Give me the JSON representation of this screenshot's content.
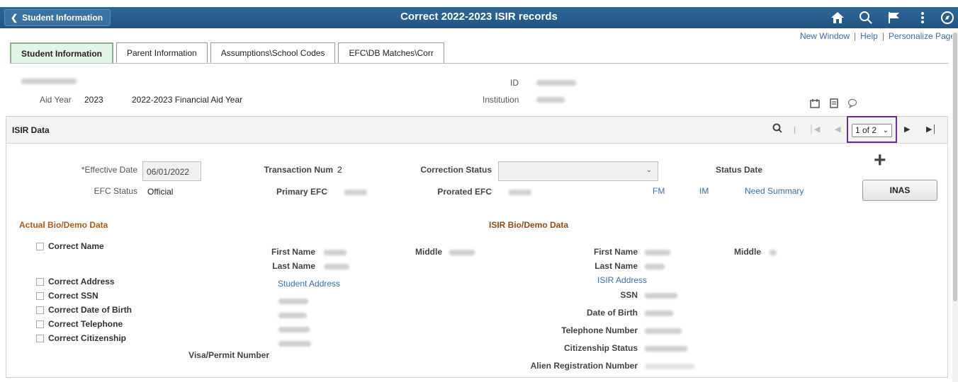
{
  "header": {
    "back_label": "Student Information",
    "title": "Correct 2022-2023 ISIR records",
    "icons": [
      "home-icon",
      "search-icon",
      "flag-icon",
      "more-icon",
      "navigator-icon"
    ]
  },
  "toplinks": {
    "new_window": "New Window",
    "help": "Help",
    "personalize": "Personalize Page"
  },
  "tabs": [
    {
      "label": "Student Information",
      "active": true
    },
    {
      "label": "Parent Information",
      "active": false
    },
    {
      "label": "Assumptions\\School Codes",
      "active": false
    },
    {
      "label": "EFC\\DB Matches\\Corr",
      "active": false
    }
  ],
  "info": {
    "aid_year_label": "Aid Year",
    "aid_year_value": "2023",
    "aid_year_desc": "2022-2023 Financial Aid Year",
    "id_label": "ID",
    "institution_label": "Institution"
  },
  "isir": {
    "title": "ISIR Data",
    "pager_value": "1 of 2",
    "effective_date_label": "*Effective Date",
    "effective_date_value": "06/01/2022",
    "transaction_num_label": "Transaction Num",
    "transaction_num_value": "2",
    "correction_status_label": "Correction Status",
    "status_date_label": "Status Date",
    "efc_status_label": "EFC Status",
    "efc_status_value": "Official",
    "primary_efc_label": "Primary EFC",
    "prorated_efc_label": "Prorated EFC",
    "link_fm": "FM",
    "link_im": "IM",
    "link_need_summary": "Need Summary",
    "inas_label": "INAS"
  },
  "actual": {
    "title": "Actual Bio/Demo Data",
    "checks": [
      "Correct Name",
      "Correct Address",
      "Correct SSN",
      "Correct Date of Birth",
      "Correct Telephone",
      "Correct Citizenship"
    ],
    "first_name_label": "First Name",
    "middle_label": "Middle",
    "last_name_label": "Last Name",
    "student_address_link": "Student Address",
    "visa_label": "Visa/Permit Number"
  },
  "isir_bio": {
    "title": "ISIR Bio/Demo Data",
    "first_name_label": "First Name",
    "middle_label": "Middle",
    "last_name_label": "Last Name",
    "isir_address_link": "ISIR Address",
    "ssn_label": "SSN",
    "dob_label": "Date of Birth",
    "phone_label": "Telephone Number",
    "citizenship_label": "Citizenship Status",
    "alien_label": "Alien Registration Number"
  }
}
